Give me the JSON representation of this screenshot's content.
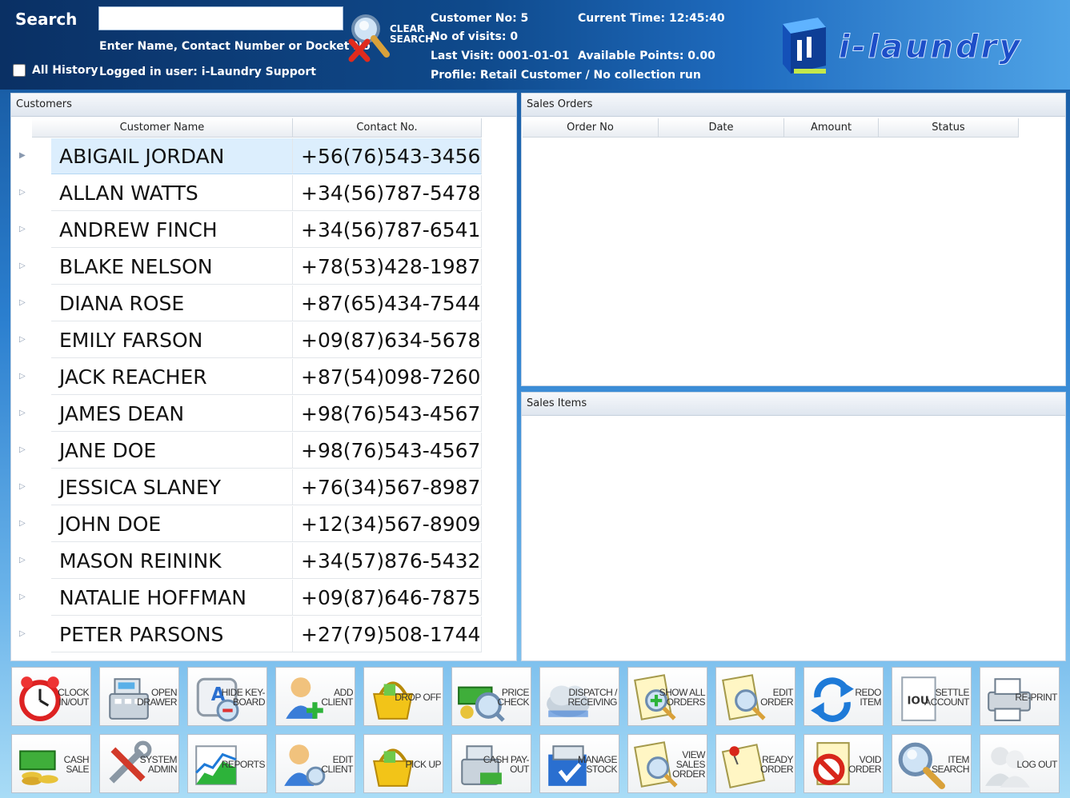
{
  "header": {
    "search_label": "Search",
    "search_value": "",
    "search_hint": "Enter Name, Contact Number or Docket No",
    "all_history_label": "All History",
    "logged_user": "Logged in user: i-Laundry Support",
    "clear_search_label_1": "CLEAR",
    "clear_search_label_2": "SEARCH",
    "customer_no": "Customer No: 5",
    "visits": "No of visits: 0",
    "last_visit": "Last Visit: 0001-01-01",
    "profile": "Profile:  Retail Customer  / No collection run",
    "current_time": "Current Time: 12:45:40",
    "available_points": "Available Points: 0.00",
    "logo_text": "i-laundry"
  },
  "customers": {
    "title": "Customers",
    "columns": [
      "Customer Name",
      "Contact No."
    ],
    "rows": [
      {
        "name": "ABIGAIL JORDAN",
        "contact": "+56(76)543-3456"
      },
      {
        "name": "ALLAN WATTS",
        "contact": "+34(56)787-5478"
      },
      {
        "name": "ANDREW FINCH",
        "contact": "+34(56)787-6541"
      },
      {
        "name": "BLAKE NELSON",
        "contact": "+78(53)428-1987"
      },
      {
        "name": "DIANA ROSE",
        "contact": "+87(65)434-7544"
      },
      {
        "name": "EMILY FARSON",
        "contact": "+09(87)634-5678"
      },
      {
        "name": "JACK REACHER",
        "contact": "+87(54)098-7260"
      },
      {
        "name": "JAMES DEAN",
        "contact": "+98(76)543-4567"
      },
      {
        "name": "JANE DOE",
        "contact": "+98(76)543-4567"
      },
      {
        "name": "JESSICA SLANEY",
        "contact": "+76(34)567-8987"
      },
      {
        "name": "JOHN DOE",
        "contact": "+12(34)567-8909"
      },
      {
        "name": "MASON REININK",
        "contact": "+34(57)876-5432"
      },
      {
        "name": "NATALIE HOFFMAN",
        "contact": "+09(87)646-7875"
      },
      {
        "name": "PETER PARSONS",
        "contact": "+27(79)508-1744"
      }
    ]
  },
  "sales_orders": {
    "title": "Sales Orders",
    "columns": [
      "Order No",
      "Date",
      "Amount",
      "Status"
    ]
  },
  "sales_items": {
    "title": "Sales Items"
  },
  "toolbar": {
    "row1": [
      {
        "label": "CLOCK IN/OUT",
        "icon": "alarm-clock-icon"
      },
      {
        "label": "OPEN DRAWER",
        "icon": "cash-register-icon"
      },
      {
        "label": "HIDE KEY-BOARD",
        "icon": "keyboard-key-icon"
      },
      {
        "label": "ADD CLIENT",
        "icon": "add-person-icon"
      },
      {
        "label": "DROP OFF",
        "icon": "basket-icon"
      },
      {
        "label": "PRICE CHECK",
        "icon": "money-magnify-icon"
      },
      {
        "label": "DISPATCH / RECEIVING",
        "icon": "cloud-icon"
      },
      {
        "label": "SHOW ALL ORDERS",
        "icon": "document-add-icon"
      },
      {
        "label": "EDIT ORDER",
        "icon": "document-search-icon"
      },
      {
        "label": "REDO ITEM",
        "icon": "redo-arrows-icon"
      },
      {
        "label": "SETTLE ACCOUNT",
        "icon": "iou-note-icon"
      },
      {
        "label": "RE-PRINT",
        "icon": "printer-icon"
      }
    ],
    "row2": [
      {
        "label": "CASH SALE",
        "icon": "cash-coins-icon"
      },
      {
        "label": "SYSTEM ADMIN",
        "icon": "tools-icon"
      },
      {
        "label": "REPORTS",
        "icon": "chart-icon"
      },
      {
        "label": "EDIT CLIENT",
        "icon": "person-search-icon"
      },
      {
        "label": "PICK UP",
        "icon": "basket-icon"
      },
      {
        "label": "CASH PAY-OUT",
        "icon": "register-payout-icon"
      },
      {
        "label": "MANAGE STOCK",
        "icon": "stock-folder-icon"
      },
      {
        "label": "VIEW SALES ORDER",
        "icon": "document-search-icon"
      },
      {
        "label": "READY ORDER",
        "icon": "pinned-note-icon"
      },
      {
        "label": "VOID ORDER",
        "icon": "no-entry-icon"
      },
      {
        "label": "ITEM SEARCH",
        "icon": "magnifier-icon"
      },
      {
        "label": "LOG OUT",
        "icon": "users-logout-icon"
      }
    ],
    "iou_text": "IOU"
  },
  "colors": {
    "accent": "#1a5fa8",
    "selected_row": "#dceefd",
    "brand": "#1d4ec8"
  }
}
